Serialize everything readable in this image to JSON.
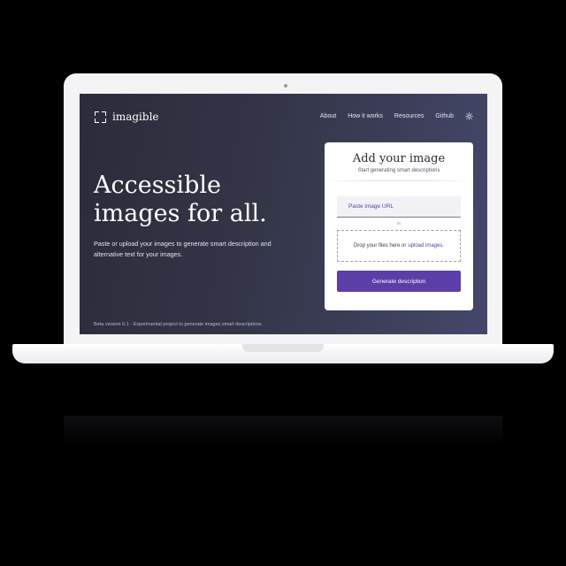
{
  "header": {
    "logo_text": "imagible",
    "nav": [
      "About",
      "How it works",
      "Resources",
      "Github"
    ],
    "theme_icon": "sun-icon"
  },
  "hero": {
    "title": "Accessible\nimages for all.",
    "subtitle": "Paste or upload your images to generate smart description and alternative text for your images."
  },
  "card": {
    "title": "Add your image",
    "subtitle": "Start generating smart descriptions",
    "url_placeholder": "Paste image URL",
    "or_label": "or",
    "dropzone_text": "Drop your files here or",
    "dropzone_link": "upload images.",
    "button_label": "Generate description"
  },
  "footer": {
    "note": "Beta version 0.1 - Experimental project to generate images smart descriptions."
  },
  "colors": {
    "accent": "#5b3ea8",
    "background_dark": "#2b2c3a",
    "background_light": "#44476a"
  }
}
